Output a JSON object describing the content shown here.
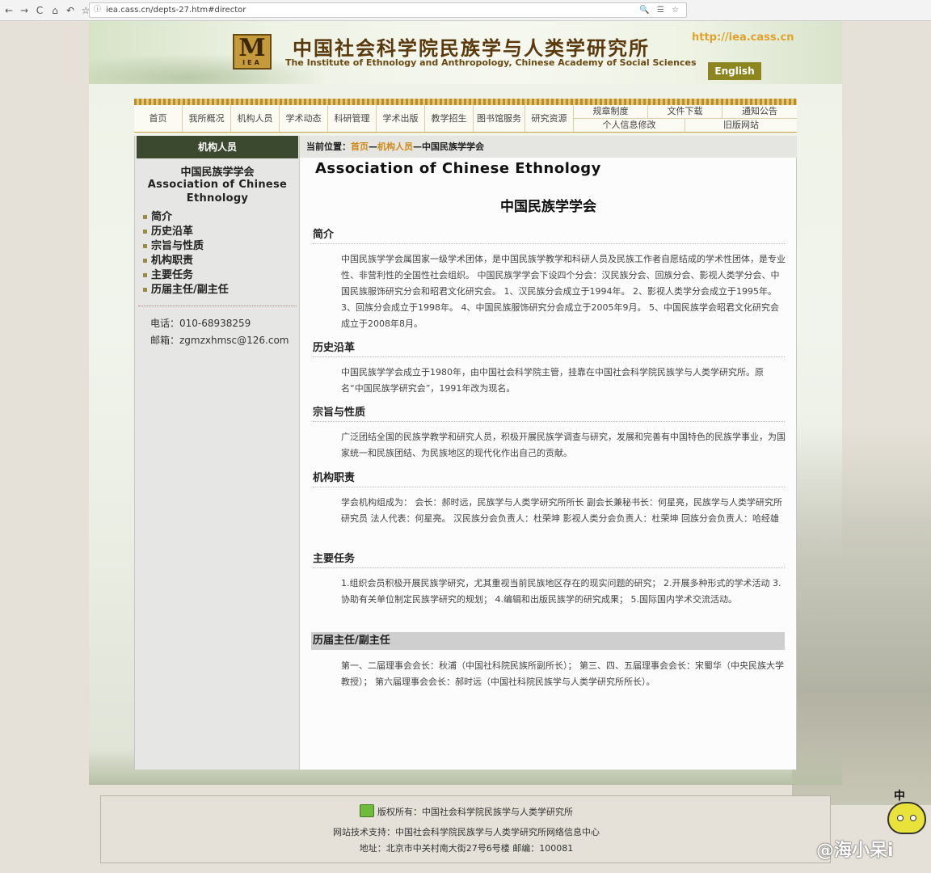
{
  "browser": {
    "url": "iea.cass.cn/depts-27.htm#director",
    "nav_icons": [
      "←",
      "→",
      "C",
      "⌂",
      "↶",
      "☆"
    ],
    "right_icons": "🔍 ☰ ☆"
  },
  "header": {
    "logo_letters": "M",
    "logo_sub": "IEA",
    "title_cn": "中国社会科学院民族学与人类学研究所",
    "title_en": "The Institute of Ethnology and Anthropology, Chinese Academy of Social Sciences",
    "site_url": "http://iea.cass.cn",
    "english_label": "English"
  },
  "nav": {
    "items": [
      "首页",
      "我所概况",
      "机构人员",
      "学术动态",
      "科研管理",
      "学术出版",
      "教学招生",
      "图书馆服务",
      "研究资源"
    ],
    "right_top": [
      "规章制度",
      "文件下载",
      "通知公告"
    ],
    "right_bottom": [
      "个人信息修改",
      "旧版网站"
    ]
  },
  "sidebar": {
    "heading": "机构人员",
    "org_cn": "中国民族学学会",
    "org_en": "Association of Chinese Ethnology",
    "links": [
      "简介",
      "历史沿革",
      "宗旨与性质",
      "机构职责",
      "主要任务",
      "历届主任/副主任"
    ],
    "phone": "电话：010-68938259",
    "email": "邮箱：zgmzxhmsc@126.com"
  },
  "content": {
    "breadcrumb_prefix": "当前位置：",
    "crumb_home": "首页",
    "crumb_sep1": "—",
    "crumb_dept": "机构人员",
    "crumb_sep2": "—",
    "crumb_current": "中国民族学学会",
    "title_en": "Association of Chinese Ethnology",
    "title_cn": "中国民族学学会",
    "sections": [
      {
        "heading": "简介",
        "body": "中国民族学学会属国家一级学术团体，是中国民族学教学和科研人员及民族工作者自愿结成的学术性团体，是专业性、非营利性的全国性社会组织。 中国民族学学会下设四个分会：汉民族分会、回族分会、影视人类学分会、中国民族服饰研究分会和昭君文化研究会。 1、汉民族分会成立于1994年。 2、影视人类学分会成立于1995年。 3、回族分会成立于1998年。 4、中国民族服饰研究分会成立于2005年9月。 5、中国民族学会昭君文化研究会成立于2008年8月。"
      },
      {
        "heading": "历史沿革",
        "body": "中国民族学学会成立于1980年，由中国社会科学院主管，挂靠在中国社会科学院民族学与人类学研究所。原名“中国民族学研究会”，1991年改为现名。"
      },
      {
        "heading": "宗旨与性质",
        "body": "广泛团结全国的民族学教学和研究人员，积极开展民族学调查与研究，发展和完善有中国特色的民族学事业，为国家统一和民族团结、为民族地区的现代化作出自己的贡献。"
      },
      {
        "heading": "机构职责",
        "body": "学会机构组成为： 会长：郝时远，民族学与人类学研究所所长 副会长兼秘书长：何星亮，民族学与人类学研究所研究员 法人代表：何星亮。 汉民族分会负责人：杜荣坤 影视人类分会负责人：杜荣坤 回族分会负责人：哈经雄"
      },
      {
        "heading": "主要任务",
        "body": "1.组织会员积极开展民族学研究，尤其重视当前民族地区存在的现实问题的研究； 2.开展多种形式的学术活动 3.协助有关单位制定民族学研究的规划； 4.编辑和出版民族学的研究成果； 5.国际国内学术交流活动。"
      },
      {
        "heading": "历届主任/副主任",
        "body": "第一、二届理事会会长：秋浦（中国社科院民族所副所长）； 第三、四、五届理事会会长：宋蜀华（中央民族大学教授）； 第六届理事会会长：郝时远（中国社科院民族学与人类学研究所所长）。"
      }
    ]
  },
  "footer": {
    "copyright": "版权所有：中国社会科学院民族学与人类学研究所",
    "support": "网站技术支持：中国社会科学院民族学与人类学研究所网络信息中心",
    "address": "地址：北京市中关村南大街27号6号楼 邮编：100081"
  },
  "overlay": {
    "watermark": "@海小呆i",
    "mascot_char": "中"
  }
}
